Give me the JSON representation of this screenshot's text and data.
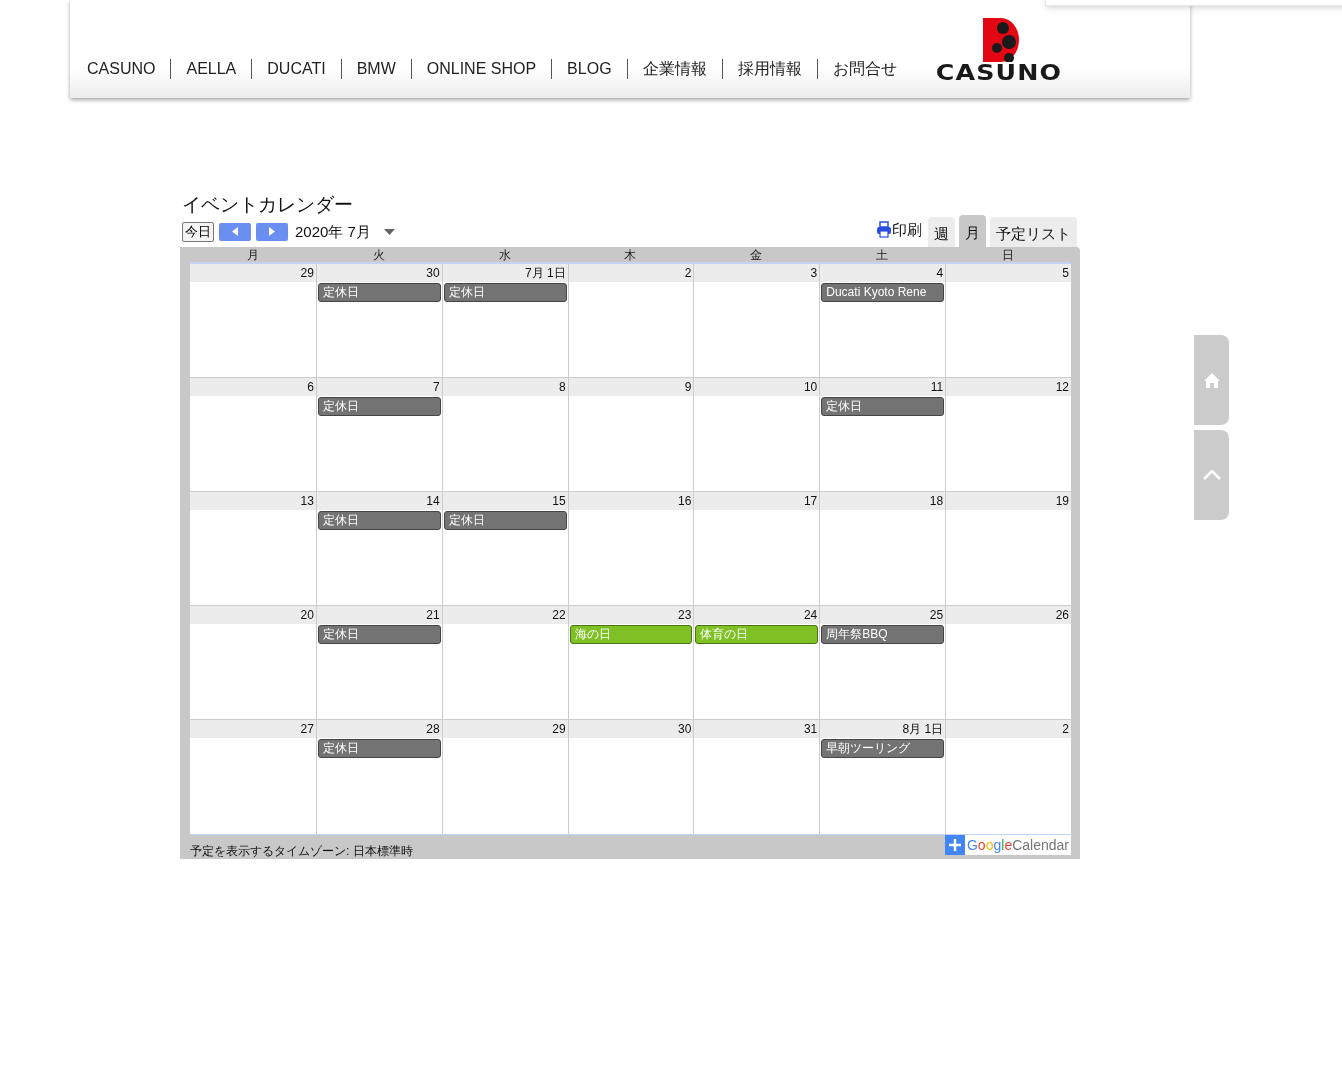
{
  "nav": {
    "items": [
      "CASUNO",
      "AELLA",
      "DUCATI",
      "BMW",
      "ONLINE SHOP",
      "BLOG",
      "企業情報",
      "採用情報",
      "お問合せ"
    ],
    "logo": "CASUNO"
  },
  "calendar": {
    "title": "イベントカレンダー",
    "today_button": "今日",
    "period": "2020年 7月",
    "print": "印刷",
    "tabs": [
      {
        "label": "週",
        "selected": false
      },
      {
        "label": "月",
        "selected": true
      },
      {
        "label": "予定リスト",
        "selected": false
      }
    ],
    "weekdays": [
      "月",
      "火",
      "水",
      "木",
      "金",
      "土",
      "日"
    ],
    "weeks": [
      [
        {
          "date": "29"
        },
        {
          "date": "30",
          "events": [
            {
              "title": "定休日",
              "color": "#737373"
            }
          ]
        },
        {
          "date": "7月 1日",
          "events": [
            {
              "title": "定休日",
              "color": "#737373"
            }
          ]
        },
        {
          "date": "2"
        },
        {
          "date": "3"
        },
        {
          "date": "4",
          "events": [
            {
              "title": "Ducati Kyoto Rene",
              "color": "#737373"
            }
          ]
        },
        {
          "date": "5"
        }
      ],
      [
        {
          "date": "6"
        },
        {
          "date": "7",
          "events": [
            {
              "title": "定休日",
              "color": "#737373"
            }
          ]
        },
        {
          "date": "8"
        },
        {
          "date": "9"
        },
        {
          "date": "10"
        },
        {
          "date": "11",
          "events": [
            {
              "title": "定休日",
              "color": "#737373"
            }
          ]
        },
        {
          "date": "12"
        }
      ],
      [
        {
          "date": "13"
        },
        {
          "date": "14",
          "events": [
            {
              "title": "定休日",
              "color": "#737373"
            }
          ]
        },
        {
          "date": "15",
          "events": [
            {
              "title": "定休日",
              "color": "#737373"
            }
          ]
        },
        {
          "date": "16"
        },
        {
          "date": "17"
        },
        {
          "date": "18"
        },
        {
          "date": "19"
        }
      ],
      [
        {
          "date": "20"
        },
        {
          "date": "21",
          "events": [
            {
              "title": "定休日",
              "color": "#737373"
            }
          ]
        },
        {
          "date": "22"
        },
        {
          "date": "23",
          "events": [
            {
              "title": "海の日",
              "color": "#7fc125"
            }
          ]
        },
        {
          "date": "24",
          "events": [
            {
              "title": "体育の日",
              "color": "#7fc125"
            }
          ]
        },
        {
          "date": "25",
          "events": [
            {
              "title": "周年祭BBQ",
              "color": "#737373"
            }
          ]
        },
        {
          "date": "26"
        }
      ],
      [
        {
          "date": "27"
        },
        {
          "date": "28",
          "events": [
            {
              "title": "定休日",
              "color": "#737373"
            }
          ]
        },
        {
          "date": "29"
        },
        {
          "date": "30"
        },
        {
          "date": "31"
        },
        {
          "date": "8月 1日",
          "events": [
            {
              "title": "早朝ツーリング",
              "color": "#737373"
            }
          ]
        },
        {
          "date": "2"
        }
      ]
    ],
    "timezone": "予定を表示するタイムゾーン: 日本標準時",
    "badge": {
      "brand": "Google",
      "product": "Calendar"
    }
  }
}
